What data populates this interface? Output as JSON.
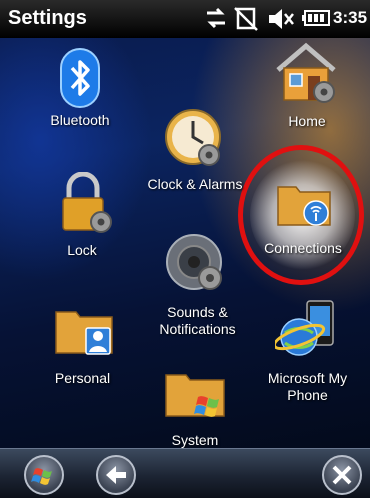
{
  "statusbar": {
    "title": "Settings",
    "time": "3:35",
    "icons": [
      "data-connection-icon",
      "no-sim-icon",
      "speaker-muted-icon",
      "battery-icon"
    ]
  },
  "items": {
    "bluetooth": "Bluetooth",
    "home": "Home",
    "clock": "Clock & Alarms",
    "lock": "Lock",
    "connections": "Connections",
    "sounds_line1": "Sounds &",
    "sounds_line2": "Notifications",
    "personal": "Personal",
    "microsoft_line1": "Microsoft My",
    "microsoft_line2": "Phone",
    "system": "System"
  },
  "highlight": {
    "target": "Connections",
    "color": "#e01010"
  },
  "bottombar": {
    "buttons": [
      "start-icon",
      "back-arrow-icon",
      "close-icon"
    ]
  }
}
